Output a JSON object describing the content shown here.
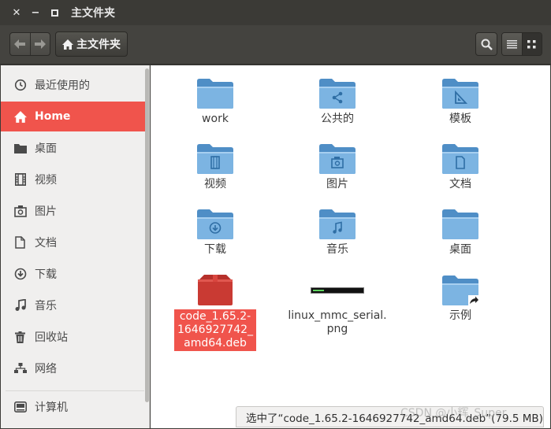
{
  "window": {
    "title": "主文件夹"
  },
  "toolbar": {
    "breadcrumb": "主文件夹"
  },
  "sidebar": {
    "items": [
      {
        "label": "最近使用的",
        "icon": "clock-icon"
      },
      {
        "label": "Home",
        "icon": "home-icon",
        "active": true
      },
      {
        "label": "桌面",
        "icon": "folder-icon"
      },
      {
        "label": "视频",
        "icon": "film-icon"
      },
      {
        "label": "图片",
        "icon": "camera-icon"
      },
      {
        "label": "文档",
        "icon": "document-icon"
      },
      {
        "label": "下载",
        "icon": "download-icon"
      },
      {
        "label": "音乐",
        "icon": "music-icon"
      },
      {
        "label": "回收站",
        "icon": "trash-icon"
      },
      {
        "label": "网络",
        "icon": "network-icon"
      }
    ],
    "computer": {
      "label": "计算机",
      "icon": "drive-icon"
    }
  },
  "files": [
    {
      "name": "work",
      "type": "folder"
    },
    {
      "name": "公共的",
      "type": "folder-share"
    },
    {
      "name": "模板",
      "type": "folder-template"
    },
    {
      "name": "视频",
      "type": "folder-video"
    },
    {
      "name": "图片",
      "type": "folder-pictures"
    },
    {
      "name": "文档",
      "type": "folder-documents"
    },
    {
      "name": "下载",
      "type": "folder-download"
    },
    {
      "name": "音乐",
      "type": "folder-music"
    },
    {
      "name": "桌面",
      "type": "folder"
    },
    {
      "name_lines": [
        "code_1.65.2-",
        "1646927742_",
        "amd64.deb"
      ],
      "type": "deb-package",
      "selected": true
    },
    {
      "name_lines": [
        "linux_mmc_serial.",
        "png"
      ],
      "type": "image"
    },
    {
      "name": "示例",
      "type": "folder-link"
    }
  ],
  "status": {
    "text": "选中了“code_1.65.2-1646927742_amd64.deb”(79.5 MB)"
  },
  "watermark": {
    "text": "CSDN @小辉_Super"
  },
  "colors": {
    "accent": "#f0544c",
    "folder": "#6aa7d9",
    "titlebar": "#3b3a36"
  }
}
